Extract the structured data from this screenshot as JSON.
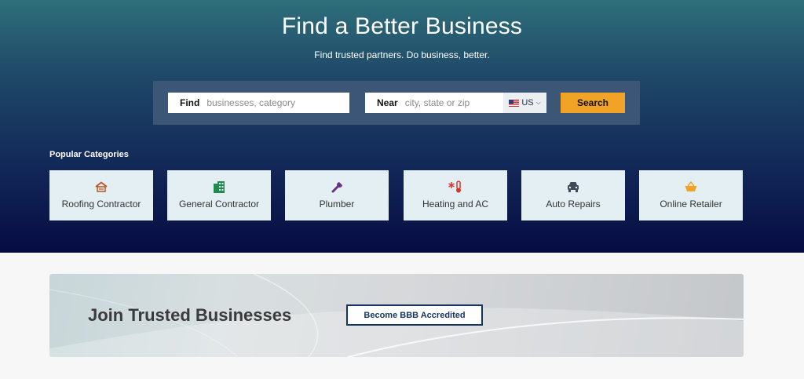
{
  "hero": {
    "title": "Find a Better Business",
    "subtitle": "Find trusted partners. Do business, better."
  },
  "search": {
    "find_label": "Find",
    "find_placeholder": "businesses, category",
    "near_label": "Near",
    "near_placeholder": "city, state or zip",
    "country": "US",
    "button": "Search"
  },
  "categories": {
    "heading": "Popular Categories",
    "items": [
      {
        "label": "Roofing Contractor",
        "icon": "roof-icon",
        "color": "#c0521c"
      },
      {
        "label": "General Contractor",
        "icon": "building-icon",
        "color": "#1f8a4c"
      },
      {
        "label": "Plumber",
        "icon": "wrench-icon",
        "color": "#6a2f86"
      },
      {
        "label": "Heating and AC",
        "icon": "thermometer-icon",
        "color": "#d8362b"
      },
      {
        "label": "Auto Repairs",
        "icon": "car-icon",
        "color": "#404a57"
      },
      {
        "label": "Online Retailer",
        "icon": "basket-icon",
        "color": "#f0a325"
      }
    ]
  },
  "join": {
    "title": "Join Trusted Businesses",
    "button": "Become BBB Accredited"
  }
}
